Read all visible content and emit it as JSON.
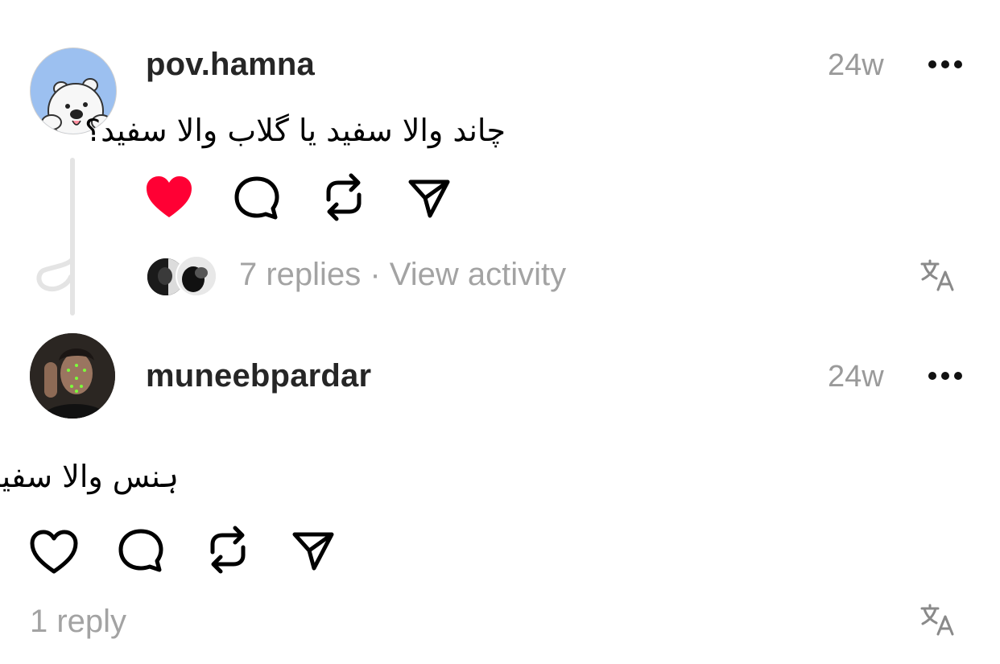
{
  "comments": [
    {
      "username": "pov.hamna",
      "time": "24w",
      "text": "چاند والا سفید یا گلاب والا سفید؟",
      "liked": true,
      "replies_text": "7 replies",
      "separator": "·",
      "view_activity": "View activity",
      "avatar": "polar-bear-avatar"
    },
    {
      "username": "muneebpardar",
      "time": "24w",
      "text": "ہنس والا سفید",
      "liked": false,
      "replies_text": "1 reply",
      "avatar": "user-photo-avatar"
    }
  ],
  "icons": {
    "like": "heart-icon",
    "comment": "comment-bubble-icon",
    "repost": "repost-icon",
    "share": "send-icon",
    "more": "more-dots-icon",
    "translate": "translate-icon"
  },
  "colors": {
    "like_active": "#ff0034",
    "muted": "#a3a3a3",
    "avatar_bg_1": "#9cc0f0"
  }
}
